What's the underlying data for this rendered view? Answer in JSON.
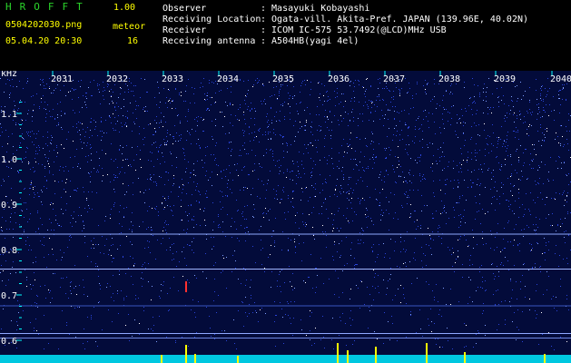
{
  "header": {
    "app_name": "HROFFT",
    "version": "1.00",
    "filename": "0504202030.png",
    "datetime": "05.04.20 20:30",
    "meteor_label": "meteor",
    "meteor_count": "16",
    "fields": [
      {
        "label": "Observer",
        "value": ": Masayuki Kobayashi"
      },
      {
        "label": "Receiving Location",
        "value": ": Ogata-vill. Akita-Pref. JAPAN (139.96E, 40.02N)"
      },
      {
        "label": "Receiver",
        "value": ": ICOM IC-575 53.7492(@LCD)MHz USB"
      },
      {
        "label": "Receiving antenna",
        "value": ": A504HB(yagi 4el)"
      }
    ]
  },
  "spectrogram": {
    "unit_label": "kHz",
    "time_ticks": [
      "2031",
      "2032",
      "2033",
      "2034",
      "2035",
      "2036",
      "2037",
      "2038",
      "2039",
      "2040"
    ],
    "freq_ticks": [
      "1.1",
      "1.0",
      "0.9",
      "0.8",
      "0.7",
      "0.6"
    ],
    "colors": {
      "background": "#0a1a6e",
      "noise": "#3a5cff",
      "axis": "#00ffff",
      "ticklabel": "#ffffff",
      "meteor": "#ffff00"
    }
  }
}
